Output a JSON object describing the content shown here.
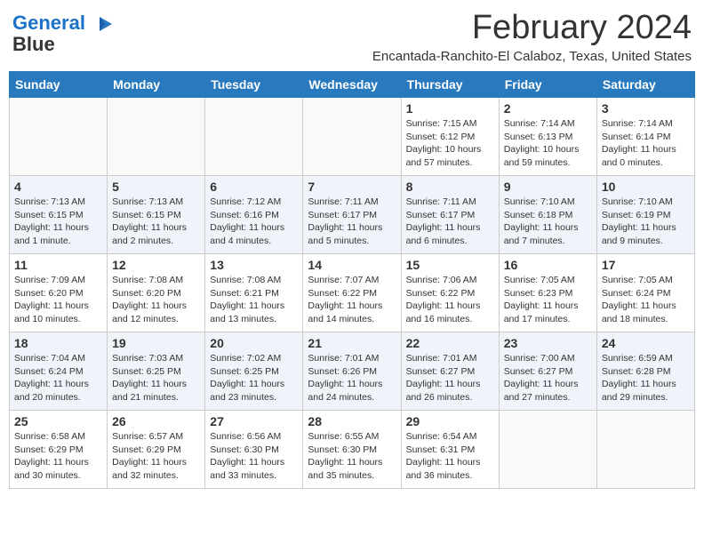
{
  "header": {
    "logo_line1": "General",
    "logo_line2": "Blue",
    "month_title": "February 2024",
    "location": "Encantada-Ranchito-El Calaboz, Texas, United States"
  },
  "columns": [
    "Sunday",
    "Monday",
    "Tuesday",
    "Wednesday",
    "Thursday",
    "Friday",
    "Saturday"
  ],
  "weeks": [
    [
      {
        "day": "",
        "info": ""
      },
      {
        "day": "",
        "info": ""
      },
      {
        "day": "",
        "info": ""
      },
      {
        "day": "",
        "info": ""
      },
      {
        "day": "1",
        "info": "Sunrise: 7:15 AM\nSunset: 6:12 PM\nDaylight: 10 hours\nand 57 minutes."
      },
      {
        "day": "2",
        "info": "Sunrise: 7:14 AM\nSunset: 6:13 PM\nDaylight: 10 hours\nand 59 minutes."
      },
      {
        "day": "3",
        "info": "Sunrise: 7:14 AM\nSunset: 6:14 PM\nDaylight: 11 hours\nand 0 minutes."
      }
    ],
    [
      {
        "day": "4",
        "info": "Sunrise: 7:13 AM\nSunset: 6:15 PM\nDaylight: 11 hours\nand 1 minute."
      },
      {
        "day": "5",
        "info": "Sunrise: 7:13 AM\nSunset: 6:15 PM\nDaylight: 11 hours\nand 2 minutes."
      },
      {
        "day": "6",
        "info": "Sunrise: 7:12 AM\nSunset: 6:16 PM\nDaylight: 11 hours\nand 4 minutes."
      },
      {
        "day": "7",
        "info": "Sunrise: 7:11 AM\nSunset: 6:17 PM\nDaylight: 11 hours\nand 5 minutes."
      },
      {
        "day": "8",
        "info": "Sunrise: 7:11 AM\nSunset: 6:17 PM\nDaylight: 11 hours\nand 6 minutes."
      },
      {
        "day": "9",
        "info": "Sunrise: 7:10 AM\nSunset: 6:18 PM\nDaylight: 11 hours\nand 7 minutes."
      },
      {
        "day": "10",
        "info": "Sunrise: 7:10 AM\nSunset: 6:19 PM\nDaylight: 11 hours\nand 9 minutes."
      }
    ],
    [
      {
        "day": "11",
        "info": "Sunrise: 7:09 AM\nSunset: 6:20 PM\nDaylight: 11 hours\nand 10 minutes."
      },
      {
        "day": "12",
        "info": "Sunrise: 7:08 AM\nSunset: 6:20 PM\nDaylight: 11 hours\nand 12 minutes."
      },
      {
        "day": "13",
        "info": "Sunrise: 7:08 AM\nSunset: 6:21 PM\nDaylight: 11 hours\nand 13 minutes."
      },
      {
        "day": "14",
        "info": "Sunrise: 7:07 AM\nSunset: 6:22 PM\nDaylight: 11 hours\nand 14 minutes."
      },
      {
        "day": "15",
        "info": "Sunrise: 7:06 AM\nSunset: 6:22 PM\nDaylight: 11 hours\nand 16 minutes."
      },
      {
        "day": "16",
        "info": "Sunrise: 7:05 AM\nSunset: 6:23 PM\nDaylight: 11 hours\nand 17 minutes."
      },
      {
        "day": "17",
        "info": "Sunrise: 7:05 AM\nSunset: 6:24 PM\nDaylight: 11 hours\nand 18 minutes."
      }
    ],
    [
      {
        "day": "18",
        "info": "Sunrise: 7:04 AM\nSunset: 6:24 PM\nDaylight: 11 hours\nand 20 minutes."
      },
      {
        "day": "19",
        "info": "Sunrise: 7:03 AM\nSunset: 6:25 PM\nDaylight: 11 hours\nand 21 minutes."
      },
      {
        "day": "20",
        "info": "Sunrise: 7:02 AM\nSunset: 6:25 PM\nDaylight: 11 hours\nand 23 minutes."
      },
      {
        "day": "21",
        "info": "Sunrise: 7:01 AM\nSunset: 6:26 PM\nDaylight: 11 hours\nand 24 minutes."
      },
      {
        "day": "22",
        "info": "Sunrise: 7:01 AM\nSunset: 6:27 PM\nDaylight: 11 hours\nand 26 minutes."
      },
      {
        "day": "23",
        "info": "Sunrise: 7:00 AM\nSunset: 6:27 PM\nDaylight: 11 hours\nand 27 minutes."
      },
      {
        "day": "24",
        "info": "Sunrise: 6:59 AM\nSunset: 6:28 PM\nDaylight: 11 hours\nand 29 minutes."
      }
    ],
    [
      {
        "day": "25",
        "info": "Sunrise: 6:58 AM\nSunset: 6:29 PM\nDaylight: 11 hours\nand 30 minutes."
      },
      {
        "day": "26",
        "info": "Sunrise: 6:57 AM\nSunset: 6:29 PM\nDaylight: 11 hours\nand 32 minutes."
      },
      {
        "day": "27",
        "info": "Sunrise: 6:56 AM\nSunset: 6:30 PM\nDaylight: 11 hours\nand 33 minutes."
      },
      {
        "day": "28",
        "info": "Sunrise: 6:55 AM\nSunset: 6:30 PM\nDaylight: 11 hours\nand 35 minutes."
      },
      {
        "day": "29",
        "info": "Sunrise: 6:54 AM\nSunset: 6:31 PM\nDaylight: 11 hours\nand 36 minutes."
      },
      {
        "day": "",
        "info": ""
      },
      {
        "day": "",
        "info": ""
      }
    ]
  ]
}
